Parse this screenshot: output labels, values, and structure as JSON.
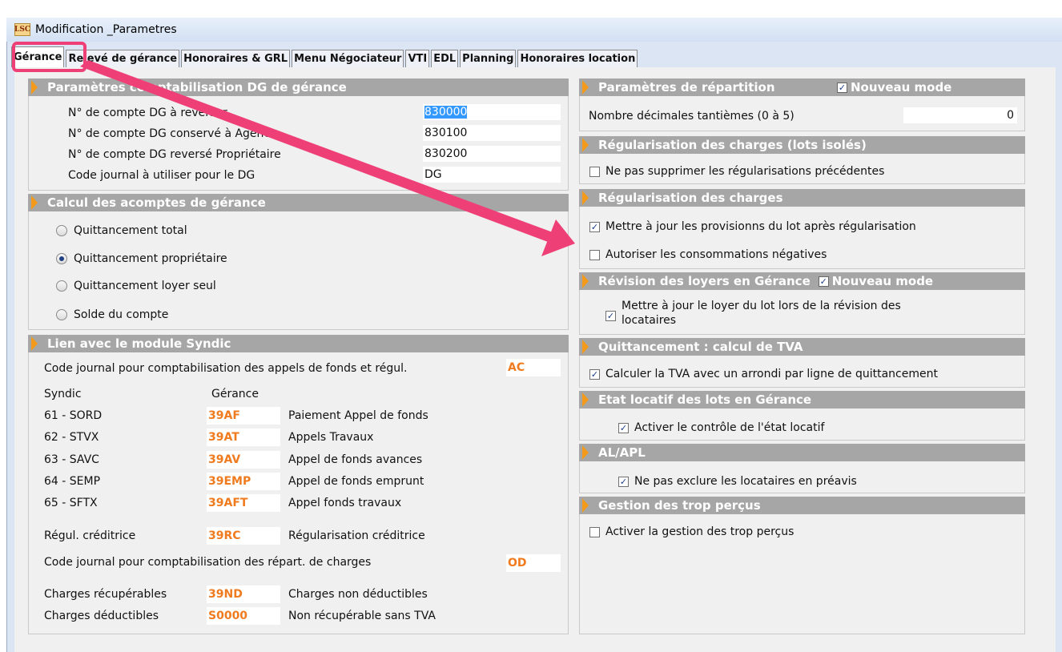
{
  "window": {
    "title": "Modification _Parametres",
    "logo_text": "LSC"
  },
  "tabs": [
    "Gérance",
    "Relevé de gérance",
    "Honoraires & GRL",
    "Menu Négociateur",
    "VTI",
    "EDL",
    "Planning",
    "Honoraires location"
  ],
  "dg": {
    "title": "Paramètres comptabilisation DG de gérance",
    "rows": [
      {
        "label": "N° de compte DG à reverser",
        "value": "830000"
      },
      {
        "label": "N° de compte DG conservé à Agence",
        "value": "830100"
      },
      {
        "label": "N° de compte DG reversé Propriétaire",
        "value": "830200"
      },
      {
        "label": "Code journal à utiliser pour le DG",
        "value": "DG"
      }
    ]
  },
  "acomptes": {
    "title": "Calcul des acomptes de gérance",
    "options": [
      {
        "label": "Quittancement total",
        "checked": false
      },
      {
        "label": "Quittancement propriétaire",
        "checked": true
      },
      {
        "label": "Quittancement loyer seul",
        "checked": false
      },
      {
        "label": "Solde du compte",
        "checked": false
      }
    ]
  },
  "syndic": {
    "title": "Lien avec le module Syndic",
    "journal_label": "Code journal pour comptabilisation des appels de fonds et régul.",
    "journal_code": "AC",
    "col_syndic": "Syndic",
    "col_gerance": "Gérance",
    "rows": [
      {
        "syndic": "61 - SORD",
        "code": "39AF",
        "desc": "Paiement Appel de fonds"
      },
      {
        "syndic": "62 - STVX",
        "code": "39AT",
        "desc": "Appels Travaux"
      },
      {
        "syndic": "63 - SAVC",
        "code": "39AV",
        "desc": "Appel de fonds avances"
      },
      {
        "syndic": "64 - SEMP",
        "code": "39EMP",
        "desc": "Appel de fonds emprunt"
      },
      {
        "syndic": "65 - SFTX",
        "code": "39AFT",
        "desc": "Appel fonds travaux"
      }
    ],
    "regul": {
      "label": "Régul. créditrice",
      "code": "39RC",
      "desc": "Régularisation créditrice"
    },
    "repart_label": "Code journal pour comptabilisation des répart. de charges",
    "repart_code": "OD",
    "charges": [
      {
        "label": "Charges récupérables",
        "code": "39ND",
        "desc": "Charges non déductibles"
      },
      {
        "label": "Charges déductibles",
        "code": "S0000",
        "desc": "Non récupérable sans TVA"
      }
    ]
  },
  "repartition": {
    "title": "Paramètres de répartition",
    "mode_label": "Nouveau mode",
    "decimals_label": "Nombre décimales tantièmes (0 à 5)",
    "decimals_value": "0"
  },
  "regul_isoles": {
    "title": "Régularisation des charges (lots isolés)",
    "item": "Ne pas supprimer les régularisations précédentes",
    "checked": false
  },
  "regul_charges": {
    "title": "Régularisation des charges",
    "items": [
      {
        "label": "Mettre à jour les provisionns du lot après régularisation",
        "checked": true
      },
      {
        "label": "Autoriser les consommations négatives",
        "checked": false
      }
    ]
  },
  "revision": {
    "title": "Révision des loyers en Gérance",
    "mode_label": "Nouveau mode",
    "item_line1": "Mettre à jour le loyer du lot lors de la révision des",
    "item_line2": "locataires",
    "checked": true
  },
  "tva": {
    "title": "Quittancement : calcul de TVA",
    "item": "Calculer la TVA avec un arrondi par ligne de quittancement",
    "checked": true
  },
  "etat": {
    "title": "Etat locatif des lots en Gérance",
    "item": "Activer le contrôle de l'état locatif",
    "checked": true
  },
  "alapl": {
    "title": "AL/APL",
    "item": "Ne pas exclure les locataires en préavis",
    "checked": true
  },
  "trop": {
    "title": "Gestion des trop perçus",
    "item": "Activer la gestion des trop perçus",
    "checked": false
  },
  "colors": {
    "accent": "#f07b1f",
    "header_bg": "#a6a6a6",
    "annotation": "#ee3f77"
  }
}
